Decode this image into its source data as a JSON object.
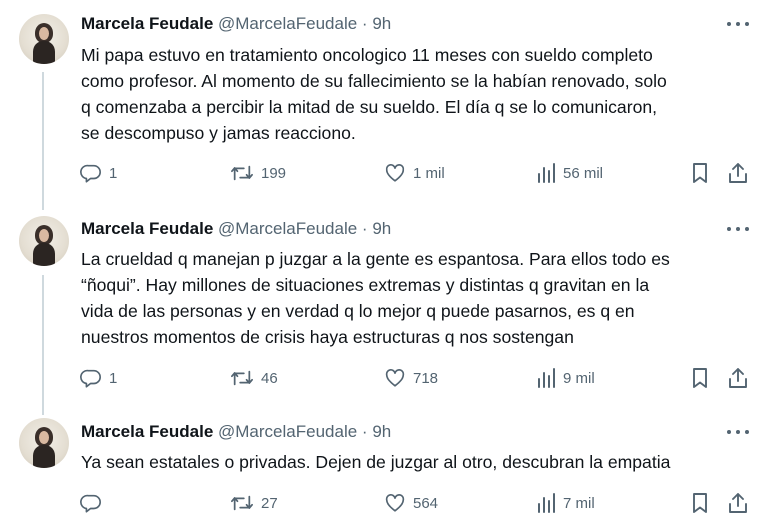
{
  "tweets": [
    {
      "name": "Marcela Feudale",
      "handle": "@MarcelaFeudale",
      "separator": "·",
      "time": "9h",
      "text": "Mi papa estuvo en tratamiento oncologico 11 meses con sueldo completo\ncomo profesor. Al momento de su fallecimiento se la habían renovado, solo\nq comenzaba a percibir la mitad de su sueldo. El día q se lo comunicaron,\nse descompuso y jamas reacciono.",
      "replies": "1",
      "retweets": "199",
      "likes": "1 mil",
      "views": "56 mil"
    },
    {
      "name": "Marcela Feudale",
      "handle": "@MarcelaFeudale",
      "separator": "·",
      "time": "9h",
      "text": "La crueldad q manejan p juzgar a la gente es espantosa. Para ellos todo es\n“ñoqui”. Hay millones de situaciones extremas y distintas q gravitan en la\nvida de las personas y en verdad q lo mejor q puede pasarnos, es q en\nnuestros momentos de crisis haya estructuras q nos sostengan",
      "replies": "1",
      "retweets": "46",
      "likes": "718",
      "views": "9 mil"
    },
    {
      "name": "Marcela Feudale",
      "handle": "@MarcelaFeudale",
      "separator": "·",
      "time": "9h",
      "text": "Ya sean estatales o privadas. Dejen de juzgar al otro, descubran la empatia",
      "replies": "",
      "retweets": "27",
      "likes": "564",
      "views": "7 mil"
    }
  ],
  "icons": {
    "reply": "reply-icon",
    "retweet": "retweet-icon",
    "like": "heart-icon",
    "views": "views-icon",
    "bookmark": "bookmark-icon",
    "share": "share-icon",
    "more": "more-icon"
  },
  "colors": {
    "text": "#0f1419",
    "secondary": "#536471",
    "thread_line": "#cfd9de"
  }
}
